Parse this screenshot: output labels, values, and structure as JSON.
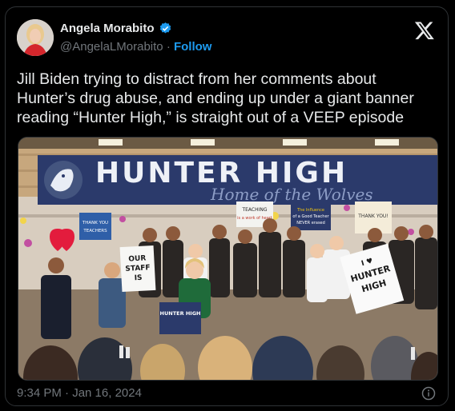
{
  "author": {
    "name": "Angela Morabito",
    "handle": "@AngelaLMorabito",
    "separator": "·",
    "follow_label": "Follow",
    "verified_color": "#1d9bf0"
  },
  "tweet": {
    "text": "Jill Biden trying to distract from her comments about Hunter’s drug abuse, and ending up under a giant banner reading “Hunter High,” is straight out of a VEEP episode",
    "timestamp": "9:34 PM · Jan 16, 2024"
  },
  "photo": {
    "banner_title": "HUNTER HIGH",
    "banner_script": "Home of the Wolves",
    "signs": {
      "thank_teachers": "THANK YOU TEACHERS",
      "teaching": "TEACHING is a work of heart",
      "influence": "The Influence of a Good Teacher NEVER erased",
      "thank_you": "THANK YOU!",
      "our_staff": "OUR STAFF IS",
      "hunter_high_sign": "I ♥ HUNTER HIGH",
      "podium": "HUNTER HIGH"
    }
  },
  "icons": {
    "close": "x-logo-icon",
    "info": "info-icon"
  },
  "colors": {
    "background": "#000000",
    "text": "#e7e9ea",
    "muted": "#71767b",
    "accent": "#1d9bf0",
    "banner": "#2b3a6b"
  }
}
